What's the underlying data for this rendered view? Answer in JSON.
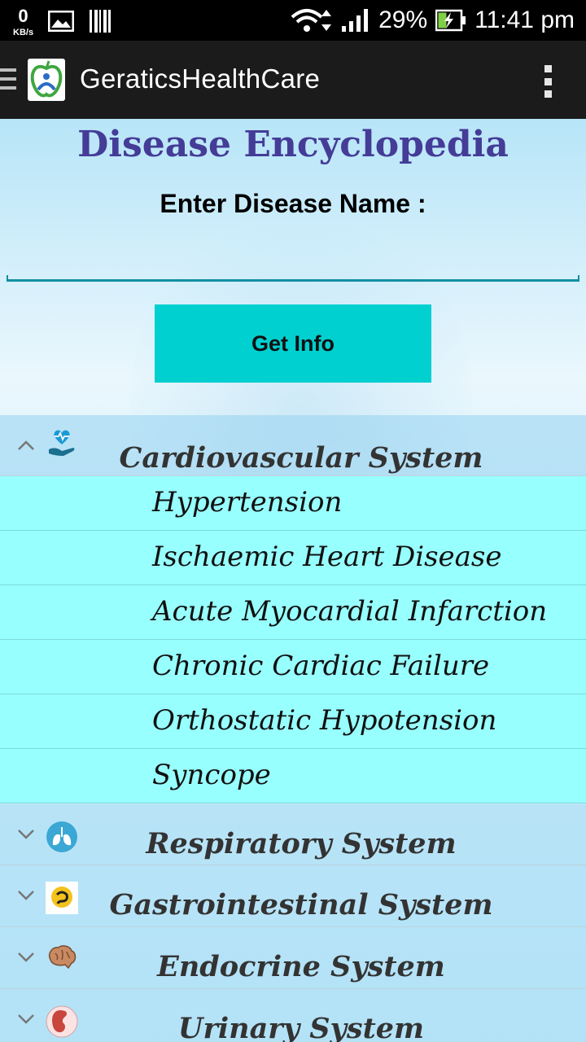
{
  "status_bar": {
    "speed_value": "0",
    "speed_unit": "KB/s",
    "battery_percent": "29%",
    "time": "11:41 pm",
    "icons": [
      "image-icon",
      "barcode-icon",
      "wifi-icon",
      "signal-icon",
      "battery-charging-icon"
    ]
  },
  "action_bar": {
    "app_title": "GeraticsHealthCare",
    "icons": [
      "drawer-icon",
      "app-logo-icon",
      "overflow-menu-icon"
    ]
  },
  "page": {
    "title": "Disease Encyclopedia",
    "prompt": "Enter Disease Name :",
    "input_value": "",
    "button_label": "Get Info"
  },
  "categories": [
    {
      "label": "Cardiovascular System",
      "icon": "heart-hand-icon",
      "expanded": true,
      "items": [
        "Hypertension",
        "Ischaemic Heart Disease",
        "Acute Myocardial Infarction",
        "Chronic Cardiac Failure",
        "Orthostatic Hypotension",
        "Syncope"
      ]
    },
    {
      "label": "Respiratory System",
      "icon": "lungs-icon",
      "expanded": false
    },
    {
      "label": "Gastrointestinal System",
      "icon": "stomach-icon",
      "expanded": false
    },
    {
      "label": "Endocrine System",
      "icon": "brain-icon",
      "expanded": false
    },
    {
      "label": "Urinary System",
      "icon": "kidney-icon",
      "expanded": false
    }
  ],
  "colors": {
    "title": "#443c97",
    "button": "#00d0d0",
    "item_bg": "#98ffff",
    "action_bar": "#1b1b1b"
  }
}
